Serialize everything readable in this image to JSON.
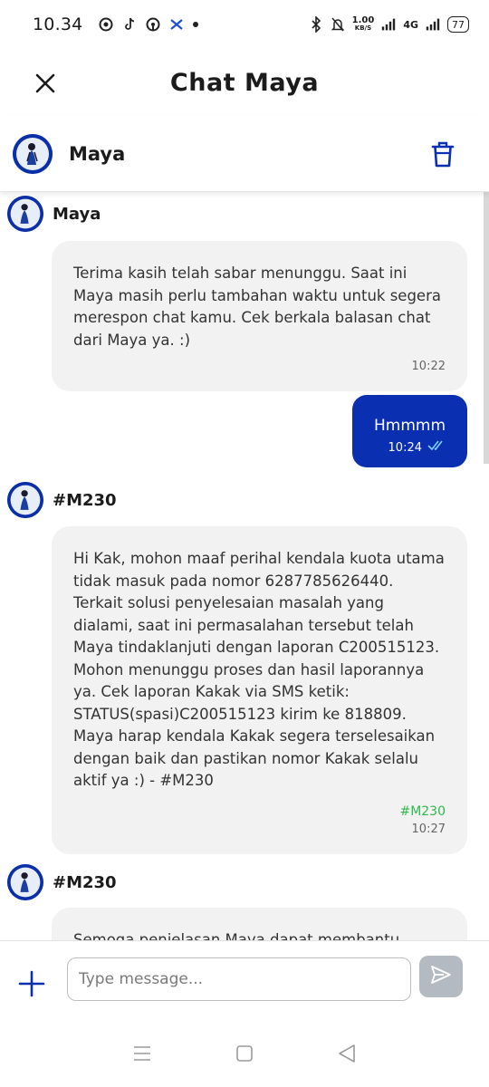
{
  "status_bar": {
    "time": "10.34",
    "net_speed_value": "1.00",
    "net_speed_unit": "KB/S",
    "network_type": "4G",
    "battery": "77"
  },
  "header": {
    "title": "Chat Maya"
  },
  "contact": {
    "name": "Maya"
  },
  "messages": [
    {
      "sender": "Maya",
      "text": "Terima kasih telah sabar menunggu. Saat ini Maya masih perlu tambahan waktu untuk segera merespon chat kamu. Cek berkala balasan chat dari Maya ya. :)",
      "time": "10:22"
    },
    {
      "text": "Hmmmm",
      "time": "10:24"
    },
    {
      "sender": "#M230",
      "text": "Hi Kak, mohon maaf perihal kendala kuota utama tidak masuk pada nomor 6287785626440. Terkait solusi penyelesaian masalah yang dialami, saat ini permasalahan tersebut telah Maya tindaklanjuti dengan laporan C200515123. Mohon menunggu proses dan hasil laporannya ya. Cek laporan Kakak via SMS ketik: STATUS(spasi)C200515123 kirim ke 818809. Maya harap kendala Kakak segera terselesaikan dengan baik dan pastikan nomor Kakak selalu aktif ya :) - #M230",
      "agent": "#M230",
      "time": "10:27"
    },
    {
      "sender": "#M230",
      "text": "Semoga penjelasan Maya dapat membantu Kakak"
    }
  ],
  "input": {
    "placeholder": "Type message..."
  },
  "colors": {
    "primary": "#0a2fb0",
    "agent_tag": "#2fb94c",
    "incoming_bubble": "#f2f2f2",
    "send_button_disabled": "#b4bac2"
  }
}
